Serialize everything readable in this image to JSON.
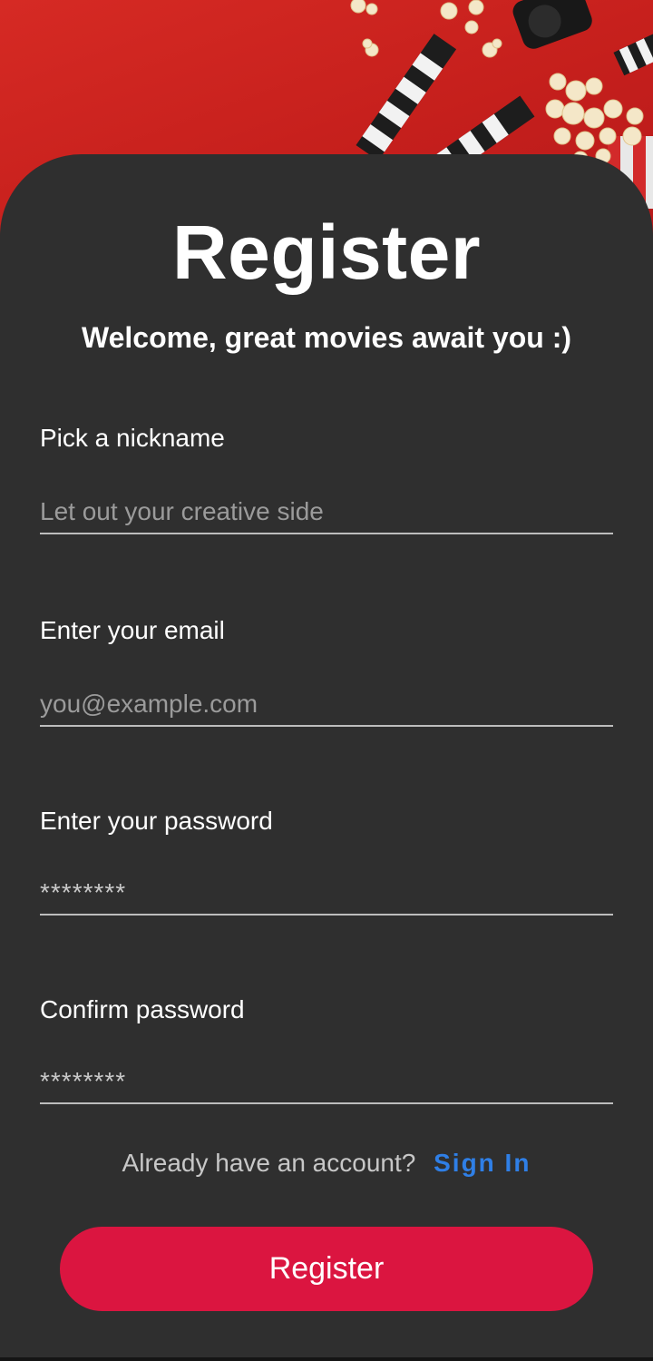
{
  "header": {
    "image_icon": "movie-props-photo",
    "background_color": "#c9221e"
  },
  "form": {
    "title": "Register",
    "subtitle": "Welcome, great movies await you :)",
    "fields": [
      {
        "label": "Pick a nickname",
        "placeholder": "Let out your creative side",
        "type": "text"
      },
      {
        "label": "Enter your email",
        "placeholder": "you@example.com",
        "type": "email"
      },
      {
        "label": "Enter your password",
        "placeholder": "********",
        "type": "password"
      },
      {
        "label": "Confirm password",
        "placeholder": "********",
        "type": "password"
      }
    ],
    "signin_prompt": "Already have an account?",
    "signin_link": "Sign In",
    "submit_label": "Register"
  },
  "colors": {
    "card_background": "#2f2f2f",
    "accent_button": "#db1540",
    "link": "#2f7fe6"
  }
}
